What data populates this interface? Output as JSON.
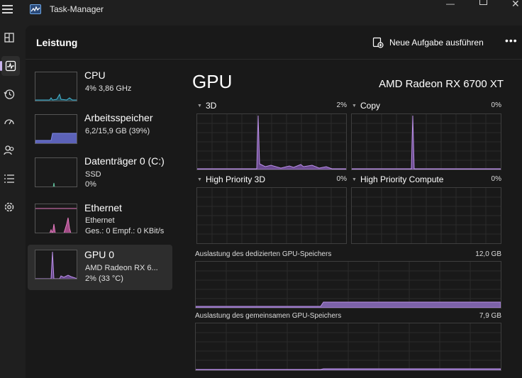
{
  "app": {
    "title": "Task-Manager"
  },
  "header": {
    "section_title": "Leistung",
    "new_task_label": "Neue Aufgabe ausführen"
  },
  "devices": [
    {
      "name": "CPU",
      "line1": "4% 3,86 GHz",
      "line2": "",
      "usage_percent": 4
    },
    {
      "name": "Arbeitsspeicher",
      "line1": "6,2/15,9 GB (39%)",
      "line2": "",
      "usage_percent": 39
    },
    {
      "name": "Datenträger 0 (C:)",
      "line1": "SSD",
      "line2": "0%",
      "usage_percent": 0
    },
    {
      "name": "Ethernet",
      "line1": "Ethernet",
      "line2": "Ges.: 0 Empf.: 0 KBit/s",
      "usage_percent": 0
    },
    {
      "name": "GPU 0",
      "line1": "AMD Radeon RX 6...",
      "line2": "2% (33 °C)",
      "usage_percent": 2
    }
  ],
  "detail": {
    "title": "GPU",
    "model": "AMD Radeon RX 6700 XT",
    "engines": [
      {
        "label": "3D",
        "value": "2%"
      },
      {
        "label": "Copy",
        "value": "0%"
      },
      {
        "label": "High Priority 3D",
        "value": "0%"
      },
      {
        "label": "High Priority Compute",
        "value": "0%"
      }
    ],
    "dedicated_memory": {
      "label": "Auslastung des dedizierten GPU-Speichers",
      "max": "12,0 GB"
    },
    "shared_memory": {
      "label": "Auslastung des gemeinsamen GPU-Speichers",
      "max": "7,9 GB"
    }
  },
  "colors": {
    "cpu": "#47b7d4",
    "memory": "#7b86e6",
    "disk": "#62c6a0",
    "ethernet": "#e67bc0",
    "gpu": "#b98ee6",
    "accent": "#c9b4ee"
  },
  "icons": [
    "hamburger-icon",
    "task-manager-icon",
    "processes-icon",
    "performance-icon",
    "app-history-icon",
    "startup-apps-icon",
    "users-icon",
    "details-icon",
    "services-icon",
    "new-task-icon",
    "more-icon"
  ]
}
